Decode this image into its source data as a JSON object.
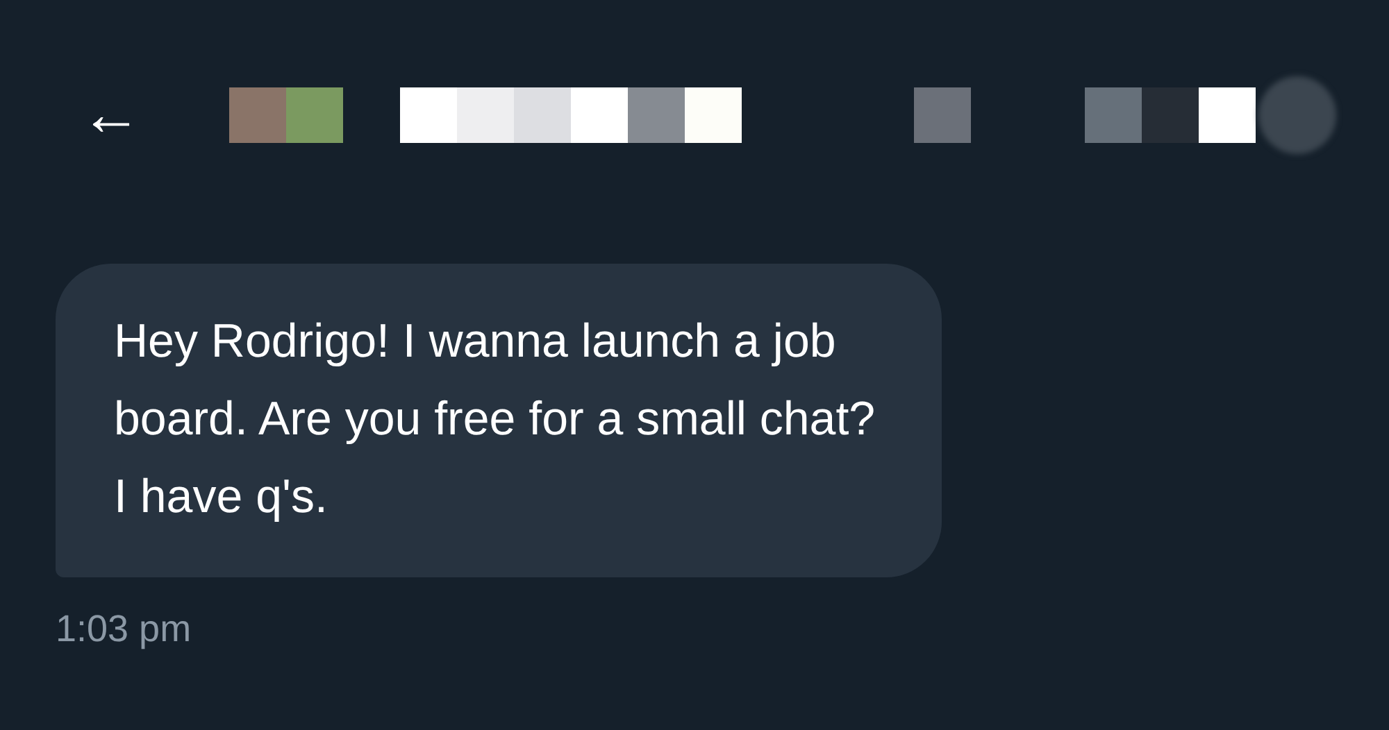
{
  "header": {
    "back": "←"
  },
  "messages": [
    {
      "text": "Hey Rodrigo! I wanna launch a job board. Are you free for a small chat? I have q's.",
      "time": "1:03 pm"
    }
  ]
}
